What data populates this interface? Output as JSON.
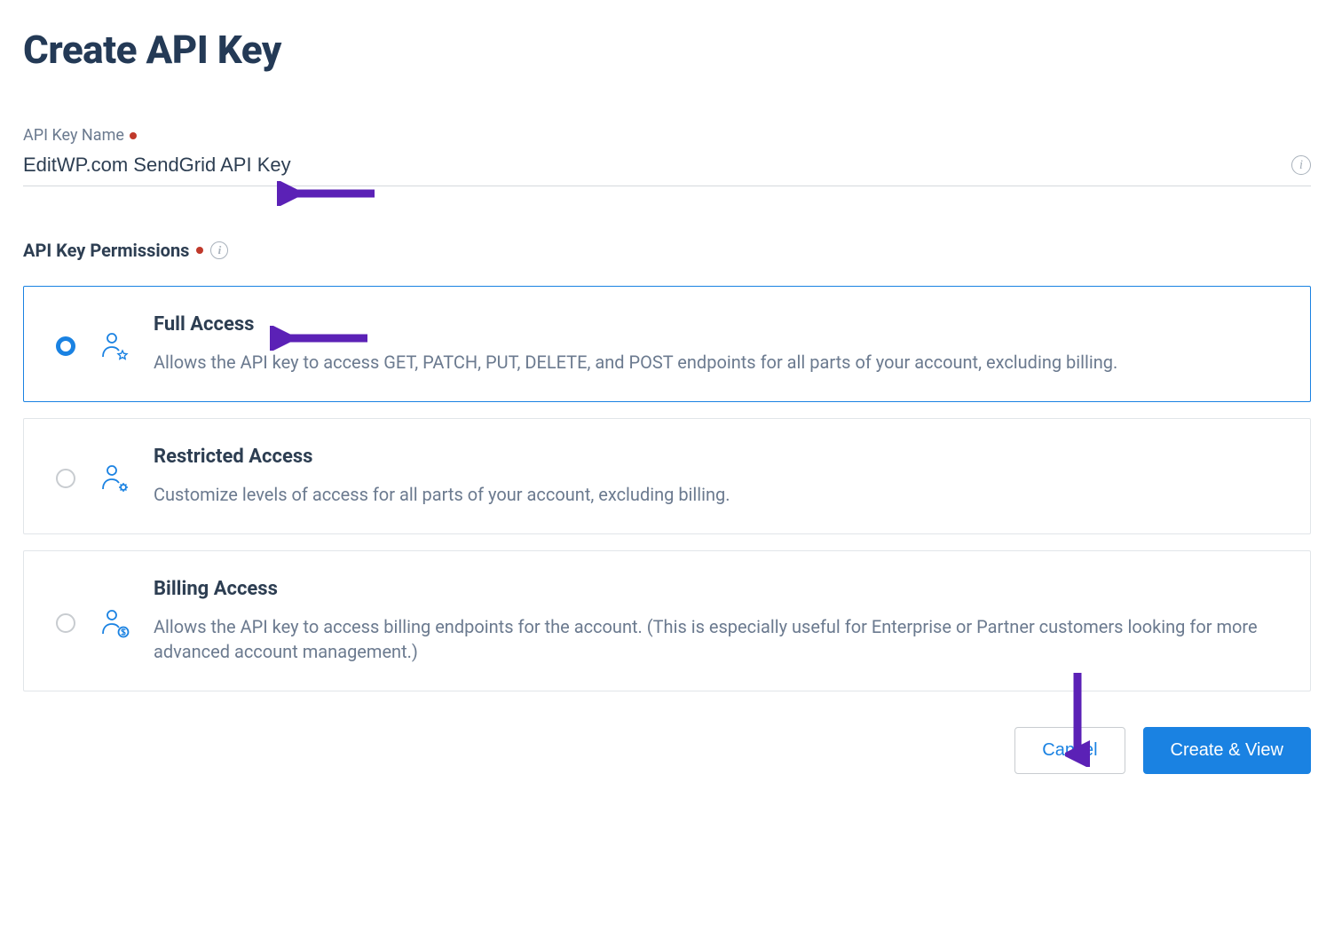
{
  "page": {
    "title": "Create API Key"
  },
  "form": {
    "name_label": "API Key Name",
    "name_value": "EditWP.com SendGrid API Key",
    "permissions_label": "API Key Permissions"
  },
  "permissions": {
    "options": [
      {
        "title": "Full Access",
        "desc": "Allows the API key to access GET, PATCH, PUT, DELETE, and POST endpoints for all parts of your account, excluding billing.",
        "selected": true
      },
      {
        "title": "Restricted Access",
        "desc": "Customize levels of access for all parts of your account, excluding billing.",
        "selected": false
      },
      {
        "title": "Billing Access",
        "desc": "Allows the API key to access billing endpoints for the account. (This is especially useful for Enterprise or Partner customers looking for more advanced account management.)",
        "selected": false
      }
    ]
  },
  "actions": {
    "cancel": "Cancel",
    "create": "Create & View"
  },
  "colors": {
    "primary": "#1a82e2",
    "text_dark": "#243a56",
    "text_muted": "#6b7a8f",
    "annotation": "#5b21b6"
  }
}
